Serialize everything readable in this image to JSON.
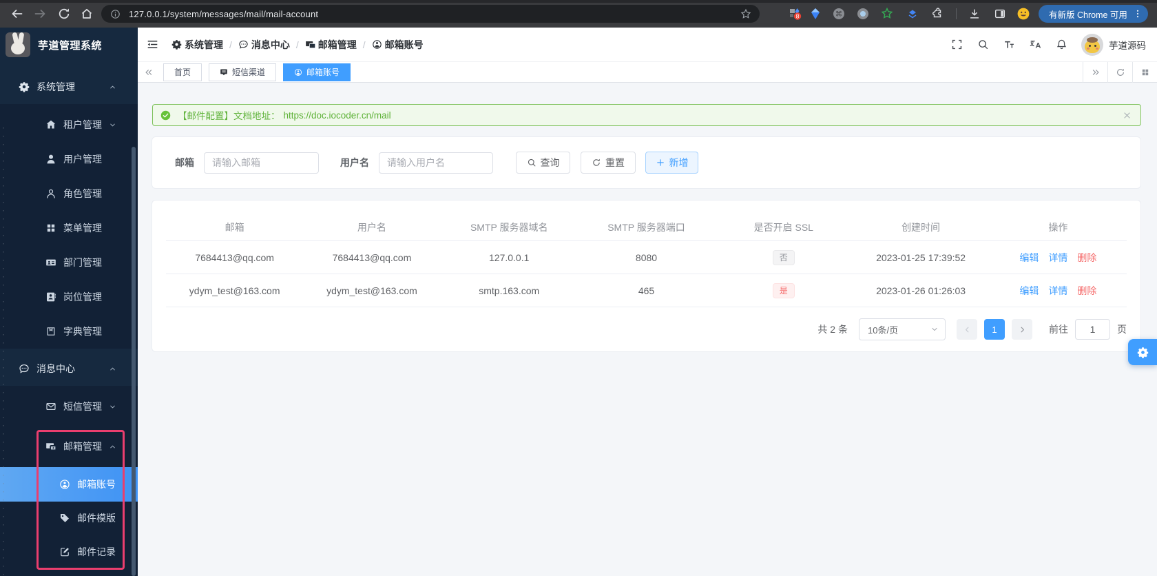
{
  "browser": {
    "url": "127.0.0.1/system/messages/mail/mail-account",
    "update_button": "有新版 Chrome 可用"
  },
  "app": {
    "logo_title": "芋道管理系统",
    "user_name": "芋道源码"
  },
  "sidebar": {
    "items": [
      {
        "label": "系统管理",
        "icon": "gear",
        "level": 1,
        "chevron": "up"
      },
      {
        "label": "租户管理",
        "icon": "home",
        "level": 2,
        "chevron": "down"
      },
      {
        "label": "用户管理",
        "icon": "user",
        "level": 2,
        "chevron": ""
      },
      {
        "label": "角色管理",
        "icon": "user-o",
        "level": 2,
        "chevron": ""
      },
      {
        "label": "菜单管理",
        "icon": "grid",
        "level": 2,
        "chevron": ""
      },
      {
        "label": "部门管理",
        "icon": "idcard",
        "level": 2,
        "chevron": ""
      },
      {
        "label": "岗位管理",
        "icon": "contact",
        "level": 2,
        "chevron": ""
      },
      {
        "label": "字典管理",
        "icon": "book",
        "level": 2,
        "chevron": ""
      },
      {
        "label": "消息中心",
        "icon": "chat",
        "level": 1,
        "chevron": "up"
      },
      {
        "label": "短信管理",
        "icon": "mail",
        "level": 2,
        "chevron": "down"
      },
      {
        "label": "邮箱管理",
        "icon": "mailsend",
        "level": 2,
        "chevron": "up"
      },
      {
        "label": "邮箱账号",
        "icon": "person-circle",
        "level": 3,
        "chevron": "",
        "active": true
      },
      {
        "label": "邮件模版",
        "icon": "tag",
        "level": 3,
        "chevron": ""
      },
      {
        "label": "邮件记录",
        "icon": "edit",
        "level": 3,
        "chevron": ""
      }
    ]
  },
  "breadcrumb": {
    "items": [
      {
        "label": "系统管理",
        "icon": "gear"
      },
      {
        "label": "消息中心",
        "icon": "chat"
      },
      {
        "label": "邮箱管理",
        "icon": "mailsend"
      },
      {
        "label": "邮箱账号",
        "icon": "person-circle"
      }
    ]
  },
  "tabs": [
    {
      "label": "首页",
      "icon": "",
      "active": false
    },
    {
      "label": "短信渠道",
      "icon": "sms",
      "active": false
    },
    {
      "label": "邮箱账号",
      "icon": "person-circle",
      "active": true
    }
  ],
  "alert": {
    "message": "【邮件配置】文档地址：",
    "link": "https://doc.iocoder.cn/mail"
  },
  "filters": {
    "email_label": "邮箱",
    "email_placeholder": "请输入邮箱",
    "username_label": "用户名",
    "username_placeholder": "请输入用户名",
    "search_button": "查询",
    "reset_button": "重置",
    "add_button": "新增"
  },
  "table": {
    "columns": [
      "邮箱",
      "用户名",
      "SMTP 服务器域名",
      "SMTP 服务器端口",
      "是否开启 SSL",
      "创建时间",
      "操作"
    ],
    "rows": [
      {
        "mail": "7684413@qq.com",
        "user": "7684413@qq.com",
        "host": "127.0.0.1",
        "port": "8080",
        "ssl": "否",
        "ssl_type": "info",
        "created": "2023-01-25 17:39:52"
      },
      {
        "mail": "ydym_test@163.com",
        "user": "ydym_test@163.com",
        "host": "smtp.163.com",
        "port": "465",
        "ssl": "是",
        "ssl_type": "danger",
        "created": "2023-01-26 01:26:03"
      }
    ],
    "actions": [
      "编辑",
      "详情",
      "删除"
    ]
  },
  "pagination": {
    "total": "共 2 条",
    "page_size": "10条/页",
    "current_page": "1",
    "goto_label": "前往",
    "goto_value": "1",
    "page_unit": "页"
  },
  "colors": {
    "primary": "#409eff",
    "success": "#67c23a",
    "danger": "#f56c6c",
    "sidebar_bg": "#16293f",
    "highlight_box": "#ea3e6e"
  }
}
